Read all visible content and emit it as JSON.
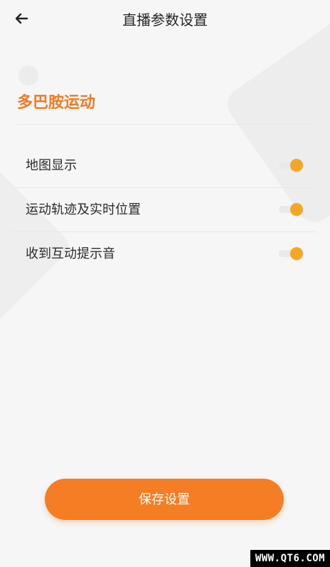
{
  "header": {
    "title": "直播参数设置",
    "back_icon": "arrow-left-icon"
  },
  "section": {
    "title": "多巴胺运动"
  },
  "settings": [
    {
      "label": "地图显示",
      "enabled": true
    },
    {
      "label": "运动轨迹及实时位置",
      "enabled": true
    },
    {
      "label": "收到互动提示音",
      "enabled": true
    }
  ],
  "actions": {
    "save_label": "保存设置"
  },
  "watermark": {
    "text": "WWW.QT6.COM"
  },
  "colors": {
    "accent": "#f57d24",
    "title_orange": "#f07a25",
    "toggle_on": "#f6a623",
    "background": "#f6f6f6"
  }
}
